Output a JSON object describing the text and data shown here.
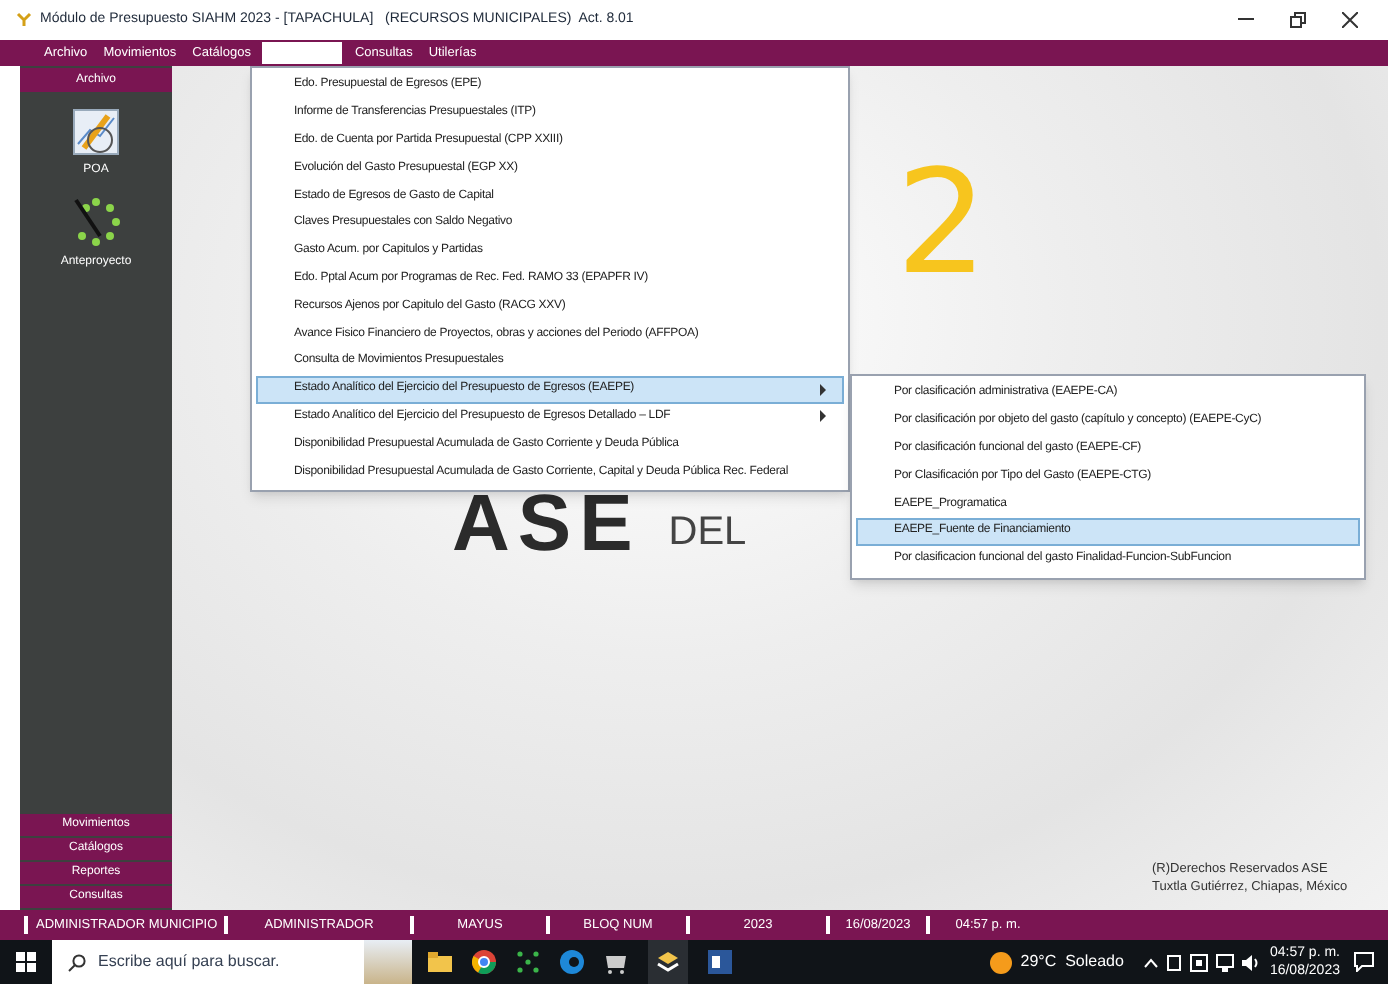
{
  "window": {
    "title": "Módulo de Presupuesto SIAHM 2023 - [TAPACHULA]   (RECURSOS MUNICIPALES)  Act. 8.01"
  },
  "menubar": [
    {
      "kind": "label",
      "label": "Archivo",
      "selected": false
    },
    {
      "kind": "label",
      "label": "Movimientos",
      "selected": false
    },
    {
      "kind": "label",
      "label": "Catálogos",
      "selected": false
    },
    {
      "kind": "blank",
      "selected": true
    },
    {
      "kind": "label",
      "label": "Consultas",
      "selected": false
    },
    {
      "kind": "label",
      "label": "Utilerías",
      "selected": false
    }
  ],
  "dropdown": {
    "items": [
      {
        "label": "Edo. Presupuestal de Egresos (EPE)",
        "selected": false,
        "submenu": false
      },
      {
        "label": "Informe de Transferencias Presupuestales (ITP)",
        "selected": false,
        "submenu": false
      },
      {
        "label": "Edo. de Cuenta por Partida Presupuestal (CPP XXIII)",
        "selected": false,
        "submenu": false
      },
      {
        "label": "Evolución del Gasto Presupuestal (EGP XX)",
        "selected": false,
        "submenu": false
      },
      {
        "label": "Estado de Egresos de Gasto de Capital",
        "selected": false,
        "submenu": false
      },
      {
        "label": "Claves Presupuestales con Saldo Negativo",
        "selected": false,
        "submenu": false
      },
      {
        "label": "Gasto Acum. por Capitulos y Partidas",
        "selected": false,
        "submenu": false
      },
      {
        "label": "Edo. Pptal Acum por Programas de Rec. Fed. RAMO 33 (EPAPFR IV)",
        "selected": false,
        "submenu": false
      },
      {
        "label": "Recursos Ajenos por Capitulo del Gasto (RACG XXV)",
        "selected": false,
        "submenu": false
      },
      {
        "label": "Avance Fisico Financiero de Proyectos, obras y acciones del Periodo (AFFPOA)",
        "selected": false,
        "submenu": false
      },
      {
        "label": "Consulta de Movimientos Presupuestales",
        "selected": false,
        "submenu": false
      },
      {
        "label": "Estado Analítico del Ejercicio del Presupuesto de Egresos (EAEPE)",
        "selected": true,
        "submenu": true
      },
      {
        "label": "Estado Analítico del Ejercicio del Presupuesto de Egresos Detallado – LDF",
        "selected": false,
        "submenu": true
      },
      {
        "label": "Disponibilidad Presupuestal Acumulada de Gasto Corriente y Deuda Pública",
        "selected": false,
        "submenu": false
      },
      {
        "label": "Disponibilidad Presupuestal Acumulada de Gasto Corriente, Capital y Deuda Pública Rec. Federal",
        "selected": false,
        "submenu": false
      }
    ]
  },
  "submenu": {
    "items": [
      {
        "label": "Por clasificación administrativa (EAEPE-CA)",
        "selected": false
      },
      {
        "label": "Por clasificación por objeto del gasto (capítulo y concepto) (EAEPE-CyC)",
        "selected": false
      },
      {
        "label": "Por clasificación funcional del gasto (EAEPE-CF)",
        "selected": false
      },
      {
        "label": "Por Clasificación por Tipo del Gasto (EAEPE-CTG)",
        "selected": false
      },
      {
        "label": "EAEPE_Programatica",
        "selected": false
      },
      {
        "label": "EAEPE_Fuente de Financiamiento",
        "selected": true
      },
      {
        "label": "Por clasificacion funcional del gasto Finalidad-Funcion-SubFuncion",
        "selected": false
      }
    ]
  },
  "sidebar": {
    "header": "Archivo",
    "tools": [
      {
        "kind": "chart",
        "label": "POA"
      },
      {
        "kind": "dial",
        "label": "Anteproyecto"
      }
    ],
    "sections": [
      "Movimientos",
      "Catálogos",
      "Reportes",
      "Consultas"
    ]
  },
  "annotation": "2",
  "logo": {
    "letters": "ASE",
    "tail": "DEL"
  },
  "copyright": [
    "(R)Derechos Reservados ASE",
    "Tuxtla Gutiérrez, Chiapas, México"
  ],
  "status_bar": [
    "ADMINISTRADOR MUNICIPIO",
    "ADMINISTRADOR",
    "MAYUS",
    "BLOQ NUM",
    "2023",
    "16/08/2023",
    "04:57 p. m."
  ],
  "taskbar": {
    "search_placeholder": "Escribe aquí para buscar.",
    "weather": "29°C  Soleado",
    "time": "04:57 p. m.",
    "date": "16/08/2023"
  }
}
